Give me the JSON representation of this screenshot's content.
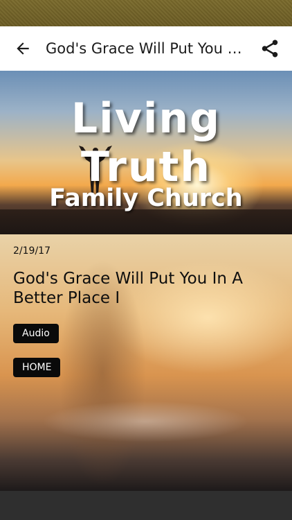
{
  "header": {
    "title": "God's Grace Will Put You In A Better Place I",
    "back_icon": "arrow-left-icon",
    "share_icon": "share-icon"
  },
  "banner": {
    "title": "Living Truth",
    "subtitle": "Family Church"
  },
  "sermon": {
    "date": "2/19/17",
    "title": "God's Grace Will Put You In A Better Place I",
    "buttons": {
      "audio": "Audio",
      "home": "HOME"
    }
  },
  "colors": {
    "status_bar": "#6b5c24",
    "app_bar": "#ffffff",
    "button_bg": "#0a0a0a",
    "bottom_bar": "#2f2f2f"
  }
}
